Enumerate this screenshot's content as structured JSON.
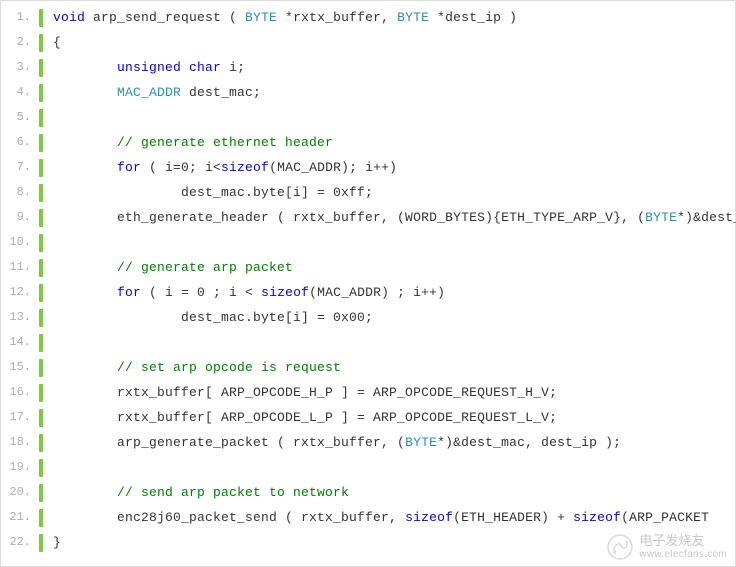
{
  "watermark": {
    "brand": "电子发烧友",
    "url": "www.elecfans.com"
  },
  "lines": [
    {
      "n": "1.",
      "indent": 0,
      "tokens": [
        [
          "kw",
          "void"
        ],
        [
          "",
          " arp_send_request ( "
        ],
        [
          "type",
          "BYTE"
        ],
        [
          "",
          " *rxtx_buffer, "
        ],
        [
          "type",
          "BYTE"
        ],
        [
          "",
          " *dest_ip )"
        ]
      ]
    },
    {
      "n": "2.",
      "indent": 0,
      "tokens": [
        [
          "",
          "{"
        ]
      ]
    },
    {
      "n": "3.",
      "indent": 2,
      "tokens": [
        [
          "kw",
          "unsigned"
        ],
        [
          "",
          " "
        ],
        [
          "kw",
          "char"
        ],
        [
          "",
          " i;"
        ]
      ]
    },
    {
      "n": "4.",
      "indent": 2,
      "tokens": [
        [
          "type",
          "MAC_ADDR"
        ],
        [
          "",
          " dest_mac;"
        ]
      ]
    },
    {
      "n": "5.",
      "indent": 0,
      "tokens": []
    },
    {
      "n": "6.",
      "indent": 2,
      "tokens": [
        [
          "cm",
          "// generate ethernet header"
        ]
      ]
    },
    {
      "n": "7.",
      "indent": 2,
      "tokens": [
        [
          "kw",
          "for"
        ],
        [
          "",
          " ( i=0; i<"
        ],
        [
          "kw",
          "sizeof"
        ],
        [
          "",
          "(MAC_ADDR); i++)"
        ]
      ]
    },
    {
      "n": "8.",
      "indent": 4,
      "tokens": [
        [
          "",
          "dest_mac.byte[i] = 0xff;"
        ]
      ]
    },
    {
      "n": "9.",
      "indent": 2,
      "tokens": [
        [
          "",
          "eth_generate_header ( rxtx_buffer, (WORD_BYTES){ETH_TYPE_ARP_V}, ("
        ],
        [
          "type",
          "BYTE"
        ],
        [
          "",
          "*)&dest_mac );"
        ]
      ]
    },
    {
      "n": "10.",
      "indent": 0,
      "tokens": []
    },
    {
      "n": "11.",
      "indent": 2,
      "tokens": [
        [
          "cm",
          "// generate arp packet"
        ]
      ]
    },
    {
      "n": "12.",
      "indent": 2,
      "tokens": [
        [
          "kw",
          "for"
        ],
        [
          "",
          " ( i = 0 ; i < "
        ],
        [
          "kw",
          "sizeof"
        ],
        [
          "",
          "(MAC_ADDR) ; i++)"
        ]
      ]
    },
    {
      "n": "13.",
      "indent": 4,
      "tokens": [
        [
          "",
          "dest_mac.byte[i] = 0x00;"
        ]
      ]
    },
    {
      "n": "14.",
      "indent": 0,
      "tokens": []
    },
    {
      "n": "15.",
      "indent": 2,
      "tokens": [
        [
          "cm",
          "// set arp opcode is request"
        ]
      ]
    },
    {
      "n": "16.",
      "indent": 2,
      "tokens": [
        [
          "",
          "rxtx_buffer[ ARP_OPCODE_H_P ] = ARP_OPCODE_REQUEST_H_V;"
        ]
      ]
    },
    {
      "n": "17.",
      "indent": 2,
      "tokens": [
        [
          "",
          "rxtx_buffer[ ARP_OPCODE_L_P ] = ARP_OPCODE_REQUEST_L_V;"
        ]
      ]
    },
    {
      "n": "18.",
      "indent": 2,
      "tokens": [
        [
          "",
          "arp_generate_packet ( rxtx_buffer, ("
        ],
        [
          "type",
          "BYTE"
        ],
        [
          "",
          "*)&dest_mac, dest_ip );"
        ]
      ]
    },
    {
      "n": "19.",
      "indent": 0,
      "tokens": []
    },
    {
      "n": "20.",
      "indent": 2,
      "tokens": [
        [
          "cm",
          "// send arp packet to network"
        ]
      ]
    },
    {
      "n": "21.",
      "indent": 2,
      "tokens": [
        [
          "",
          "enc28j60_packet_send ( rxtx_buffer, "
        ],
        [
          "kw",
          "sizeof"
        ],
        [
          "",
          "(ETH_HEADER) + "
        ],
        [
          "kw",
          "sizeof"
        ],
        [
          "",
          "(ARP_PACKET"
        ]
      ]
    },
    {
      "n": "22.",
      "indent": 0,
      "tokens": [
        [
          "",
          "}"
        ]
      ]
    }
  ]
}
